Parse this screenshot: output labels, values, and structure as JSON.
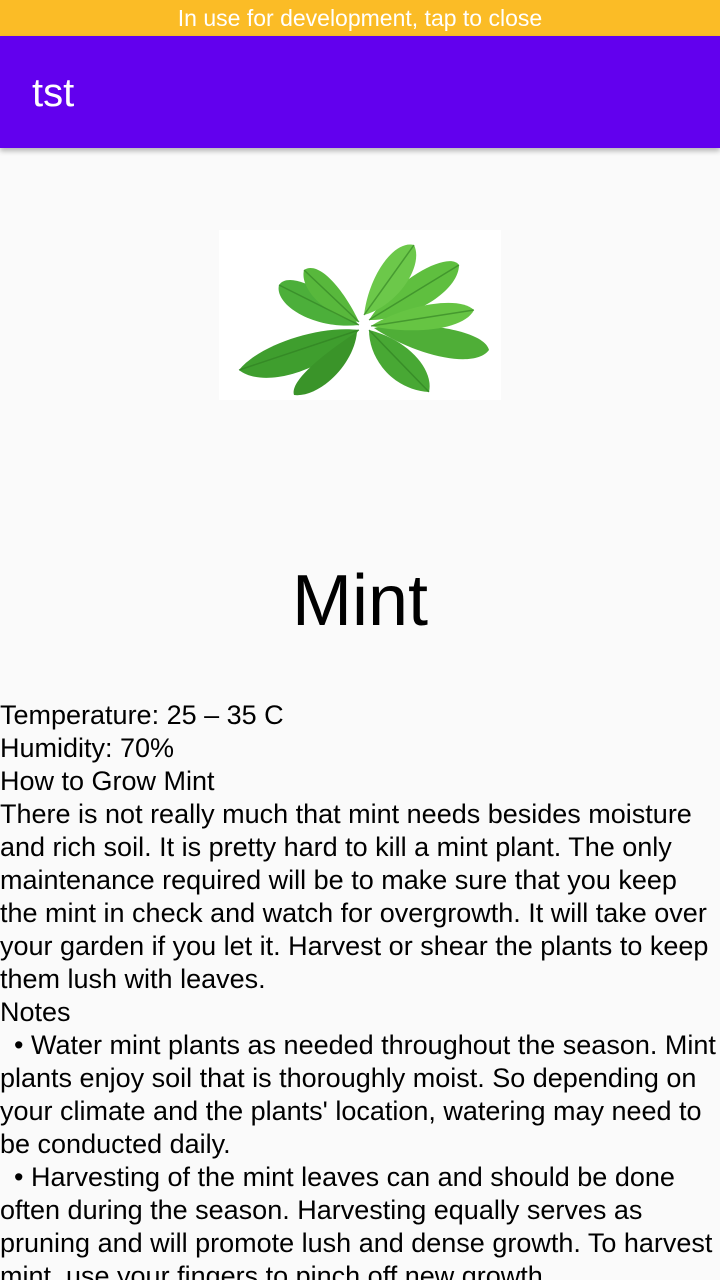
{
  "banner": {
    "text": "In use for development, tap to close"
  },
  "app_bar": {
    "title": "tst"
  },
  "plant": {
    "image": "mint-leaves-photo",
    "name": "Mint",
    "temperature": "Temperature: 25 – 35 C",
    "humidity": "Humidity: 70%",
    "how_to_heading": "How to Grow Mint",
    "how_to_body": "There is not really much that mint needs besides moisture and rich soil. It is pretty hard to kill a mint plant. The only maintenance required will be to make sure that you keep the mint in check and watch for overgrowth. It will take over your garden if you let it. Harvest or shear the plants to keep them lush with leaves.",
    "notes_heading": "Notes",
    "notes": [
      "Water mint plants as needed throughout the season. Mint plants enjoy soil that is thoroughly moist. So depending on your climate and the plants' location, watering may need to be conducted daily.",
      "Harvesting of the mint leaves can and should be done often during the season. Harvesting equally serves as pruning and will promote lush and dense growth. To harvest mint, use your fingers to pinch off new growth"
    ]
  },
  "colors": {
    "banner": "#fbbc26",
    "app_bar": "#6200ee",
    "background": "#fafafa"
  }
}
